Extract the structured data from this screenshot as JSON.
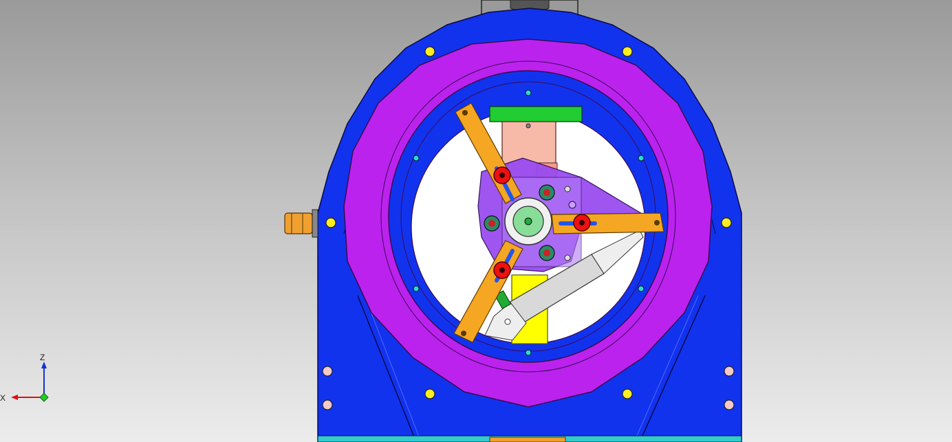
{
  "scene": {
    "colors": {
      "background_top": "#9a9a9a",
      "background_bottom": "#ececec",
      "housing": "#1133ee",
      "ring": "#bb22ee",
      "arm": "#f5a623",
      "bolt": "#ee1111",
      "bracket": "#9a4cf0",
      "block_green": "#22cc33",
      "cylinder_pink": "#f7b9a8",
      "support_yellow": "#ffff00",
      "pneumatic_cylinder": "#d9d9d9",
      "fitting_orange": "#f0a030"
    },
    "icons": {
      "axis_triad": "xz-axis-triad-icon",
      "housing_bolt": "bolt-icon"
    }
  },
  "axis_triad": {
    "z_label": "Z",
    "x_label": "X"
  }
}
